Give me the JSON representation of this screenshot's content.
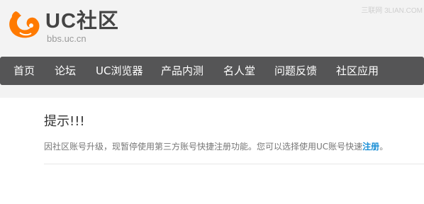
{
  "header": {
    "logo_text": "UC社区",
    "logo_subtext": "bbs.uc.cn",
    "watermark": "三联网 3LIAN.COM"
  },
  "nav": {
    "items": [
      {
        "label": "首页"
      },
      {
        "label": "论坛"
      },
      {
        "label": "UC浏览器"
      },
      {
        "label": "产品内测"
      },
      {
        "label": "名人堂"
      },
      {
        "label": "问题反馈"
      },
      {
        "label": "社区应用"
      }
    ]
  },
  "notice": {
    "title": "提示!!!",
    "message": "因社区账号升级，现暂停使用第三方账号快捷注册功能。您可以选择使用UC账号快速",
    "link_label": "注册",
    "suffix": "。"
  },
  "colors": {
    "accent": "#ff7a00",
    "nav_bg": "#555556",
    "link": "#1a8fd6"
  }
}
